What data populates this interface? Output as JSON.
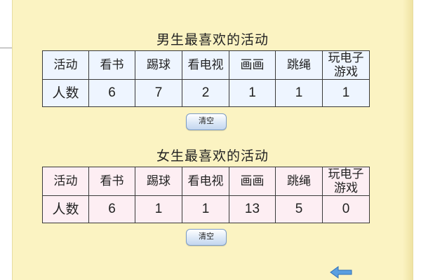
{
  "boys": {
    "title": "男生最喜欢的活动",
    "row_label_activity": "活动",
    "row_label_count": "人数",
    "activities": [
      "看书",
      "踢球",
      "看电视",
      "画画",
      "跳绳",
      "玩电子游戏"
    ],
    "activity_lines": [
      [
        "看书"
      ],
      [
        "踢球"
      ],
      [
        "看电视"
      ],
      [
        "画画"
      ],
      [
        "跳绳"
      ],
      [
        "玩电子",
        "游戏"
      ]
    ],
    "counts": [
      "6",
      "7",
      "2",
      "1",
      "1",
      "1"
    ],
    "clear_label": "清空"
  },
  "girls": {
    "title": "女生最喜欢的活动",
    "row_label_activity": "活动",
    "row_label_count": "人数",
    "activities": [
      "看书",
      "踢球",
      "看电视",
      "画画",
      "跳绳",
      "玩电子游戏"
    ],
    "activity_lines": [
      [
        "看书"
      ],
      [
        "踢球"
      ],
      [
        "看电视"
      ],
      [
        "画画"
      ],
      [
        "跳绳"
      ],
      [
        "玩电子",
        "游戏"
      ]
    ],
    "counts": [
      "6",
      "1",
      "1",
      "13",
      "5",
      "0"
    ],
    "clear_label": "清空"
  },
  "colors": {
    "panel_background": "#fbf3c2",
    "boys_cell_tint": "#eef5ff",
    "girls_cell_tint": "#fdeef3",
    "back_arrow": "#5b9fe0"
  },
  "icons": {
    "back": "back-arrow-icon"
  }
}
